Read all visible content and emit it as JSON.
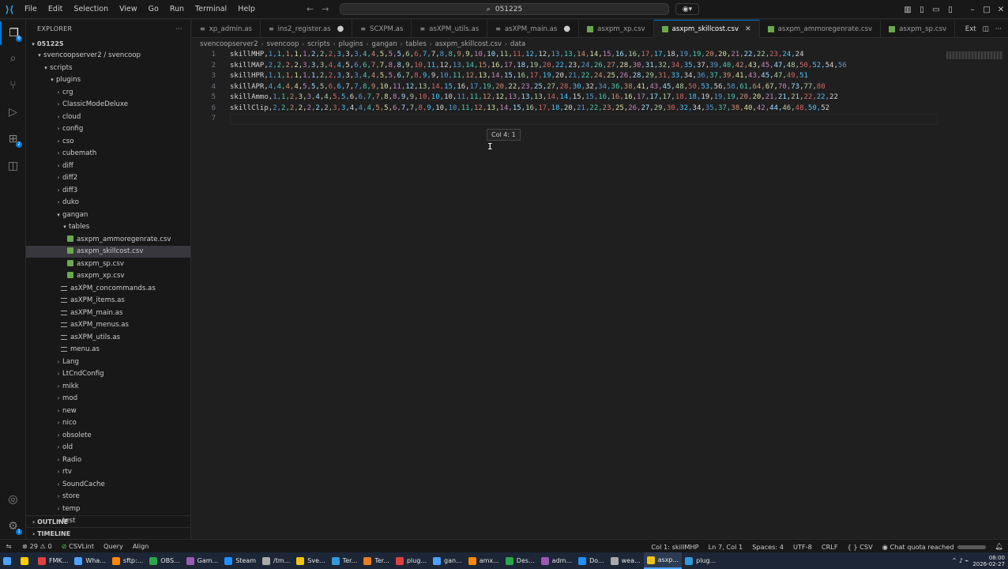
{
  "menu": [
    "File",
    "Edit",
    "Selection",
    "View",
    "Go",
    "Run",
    "Terminal",
    "Help"
  ],
  "command_center": {
    "search_text": "051225"
  },
  "explorer": {
    "header": "EXPLORER",
    "root": "051225",
    "items": [
      {
        "label": "svencoopserver2 / svencoop",
        "type": "folder-open",
        "indent": 1
      },
      {
        "label": "scripts",
        "type": "folder-open",
        "indent": 2
      },
      {
        "label": "plugins",
        "type": "folder-open",
        "indent": 3
      },
      {
        "label": "crg",
        "type": "folder",
        "indent": 4
      },
      {
        "label": "ClassicModeDeluxe",
        "type": "folder",
        "indent": 4
      },
      {
        "label": "cloud",
        "type": "folder",
        "indent": 4
      },
      {
        "label": "config",
        "type": "folder",
        "indent": 4
      },
      {
        "label": "cso",
        "type": "folder",
        "indent": 4
      },
      {
        "label": "cubemath",
        "type": "folder",
        "indent": 4
      },
      {
        "label": "diff",
        "type": "folder",
        "indent": 4
      },
      {
        "label": "diff2",
        "type": "folder",
        "indent": 4
      },
      {
        "label": "diff3",
        "type": "folder",
        "indent": 4
      },
      {
        "label": "duko",
        "type": "folder",
        "indent": 4
      },
      {
        "label": "gangan",
        "type": "folder-open",
        "indent": 4
      },
      {
        "label": "tables",
        "type": "folder-open",
        "indent": 5
      },
      {
        "label": "asxpm_ammoregenrate.csv",
        "type": "csv",
        "indent": 6
      },
      {
        "label": "asxpm_skillcost.csv",
        "type": "csv",
        "indent": 6,
        "selected": true
      },
      {
        "label": "asxpm_sp.csv",
        "type": "csv",
        "indent": 6
      },
      {
        "label": "asxpm_xp.csv",
        "type": "csv",
        "indent": 6
      },
      {
        "label": "asXPM_concommands.as",
        "type": "as",
        "indent": 5
      },
      {
        "label": "asXPM_items.as",
        "type": "as",
        "indent": 5
      },
      {
        "label": "asXPM_main.as",
        "type": "as",
        "indent": 5
      },
      {
        "label": "asXPM_menus.as",
        "type": "as",
        "indent": 5
      },
      {
        "label": "asXPM_utils.as",
        "type": "as",
        "indent": 5
      },
      {
        "label": "menu.as",
        "type": "as",
        "indent": 5
      },
      {
        "label": "Lang",
        "type": "folder",
        "indent": 4
      },
      {
        "label": "LtCndConfig",
        "type": "folder",
        "indent": 4
      },
      {
        "label": "mikk",
        "type": "folder",
        "indent": 4
      },
      {
        "label": "mod",
        "type": "folder",
        "indent": 4
      },
      {
        "label": "new",
        "type": "folder",
        "indent": 4
      },
      {
        "label": "nico",
        "type": "folder",
        "indent": 4
      },
      {
        "label": "obsolete",
        "type": "folder",
        "indent": 4
      },
      {
        "label": "old",
        "type": "folder",
        "indent": 4
      },
      {
        "label": "Radio",
        "type": "folder",
        "indent": 4
      },
      {
        "label": "rtv",
        "type": "folder",
        "indent": 4
      },
      {
        "label": "SoundCache",
        "type": "folder",
        "indent": 4
      },
      {
        "label": "store",
        "type": "folder",
        "indent": 4
      },
      {
        "label": "temp",
        "type": "folder",
        "indent": 4
      },
      {
        "label": "test",
        "type": "folder",
        "indent": 4
      }
    ],
    "outline": "OUTLINE",
    "timeline": "TIMELINE"
  },
  "tabs": [
    {
      "label": "xp_admin.as",
      "icon": "as",
      "dirty": false,
      "active": false
    },
    {
      "label": "ins2_register.as",
      "icon": "as",
      "dirty": true,
      "active": false
    },
    {
      "label": "SCXPM.as",
      "icon": "as",
      "dirty": false,
      "active": false
    },
    {
      "label": "asXPM_utils.as",
      "icon": "as",
      "dirty": false,
      "active": false
    },
    {
      "label": "asXPM_main.as",
      "icon": "as",
      "dirty": true,
      "active": false
    },
    {
      "label": "asxpm_xp.csv",
      "icon": "csv",
      "dirty": false,
      "active": false
    },
    {
      "label": "asxpm_skillcost.csv",
      "icon": "csv",
      "dirty": false,
      "active": true
    },
    {
      "label": "asxpm_ammoregenrate.csv",
      "icon": "csv",
      "dirty": false,
      "active": false
    },
    {
      "label": "asxpm_sp.csv",
      "icon": "csv",
      "dirty": false,
      "active": false
    }
  ],
  "tab_actions": {
    "exit": "Ext"
  },
  "breadcrumb": [
    "svencoopserver2",
    "svencoop",
    "scripts",
    "plugins",
    "gangan",
    "tables",
    "asxpm_skillcost.csv",
    "data"
  ],
  "editor": {
    "lines": [
      "skillMHP,1,1,1,1,1,2,2,2,3,3,3,4,4,5,5,5,6,6,7,7,8,8,9,9,10,10,11,11,12,12,13,13,14,14,15,16,16,17,17,18,19,19,20,20,21,22,22,23,24,24",
      "skillMAP,2,2,2,2,3,3,3,4,4,5,6,6,7,7,8,8,9,10,11,12,13,14,15,16,17,18,19,20,22,23,24,26,27,28,30,31,32,34,35,37,39,40,42,43,45,47,48,50,52,54,56",
      "skillHPR,1,1,1,1,1,1,2,2,3,3,3,4,4,5,5,6,7,8,9,9,10,11,12,13,14,15,16,17,19,20,21,22,24,25,26,28,29,31,33,34,36,37,39,41,43,45,47,49,51",
      "skillAPR,4,4,4,4,5,5,5,6,6,7,7,8,9,10,11,12,13,14,15,16,17,19,20,22,23,25,27,28,30,32,34,36,38,41,43,45,48,50,53,56,58,61,64,67,70,73,77,80",
      "skillAmmo,1,1,2,3,3,4,4,5,5,6,6,7,7,8,8,9,9,10,10,10,11,11,12,12,13,13,13,14,14,15,15,16,16,16,17,17,17,18,18,19,19,19,20,20,21,21,21,22,22,22",
      "skillClip,2,2,2,2,2,2,2,3,3,4,4,4,5,5,6,7,7,8,9,10,10,11,12,13,14,15,16,17,18,20,21,22,23,25,26,27,29,30,32,34,35,37,38,40,42,44,46,48,50,52",
      ""
    ],
    "tooltip": "Col 4: 1"
  },
  "status": {
    "errors": "29",
    "warnings": "0",
    "csvlint": "CSVLint",
    "query": "Query",
    "align": "Align",
    "col_info": "Col 1: skillMHP",
    "position": "Ln 7, Col 1",
    "spaces": "Spaces: 4",
    "encoding": "UTF-8",
    "eol": "CRLF",
    "language": "{ } CSV",
    "quota": "Chat quota reached"
  },
  "taskbar": {
    "items": [
      "FMK...",
      "Wha...",
      "sftp:...",
      "OBS...",
      "Gam...",
      "Steam",
      "/tm...",
      "Sve...",
      "Ter...",
      "Ter...",
      "plug...",
      "gan...",
      "amx...",
      "Des...",
      "adm...",
      "Do...",
      "wea...",
      "asxp...",
      "plug..."
    ],
    "time": "08:00",
    "date": "2026-02-27"
  },
  "colors": {
    "accent": "#0078d4",
    "csv_icon": "#6aa84f",
    "rainbow": [
      "#d4d4d4",
      "#569cd6",
      "#4ec9b0",
      "#ce9178",
      "#dcdcaa",
      "#c586c0",
      "#9cdcfe",
      "#b5cea8",
      "#d16969",
      "#4fc1ff"
    ]
  }
}
